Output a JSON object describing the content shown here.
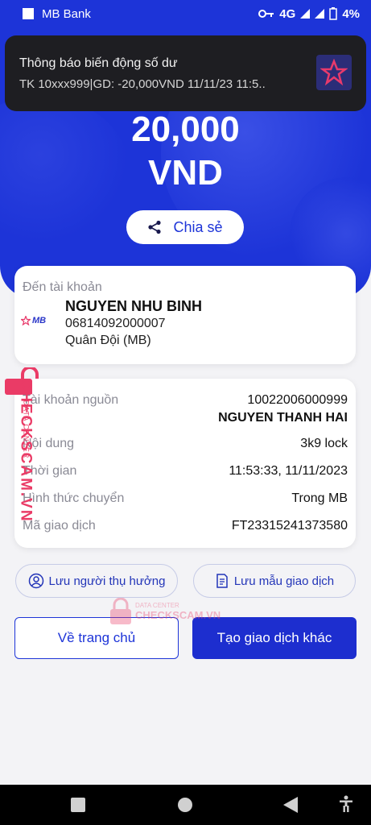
{
  "status_bar": {
    "app_name": "MB Bank",
    "network": "4G",
    "battery": "4%"
  },
  "notification": {
    "title": "Thông báo biến động số dư",
    "body": "TK 10xxx999|GD: -20,000VND 11/11/23 11:5.."
  },
  "amount": {
    "value": "20,000",
    "currency": "VND"
  },
  "share_label": "Chia sẻ",
  "recipient": {
    "label": "Đến tài khoản",
    "bank_logo": "MB",
    "name": "NGUYEN NHU BINH",
    "account": "06814092000007",
    "bank": "Quân Đội (MB)"
  },
  "details": {
    "source_label": "Tài khoản nguồn",
    "source_account": "10022006000999",
    "source_name": "NGUYEN THANH HAI",
    "content_label": "Nội dung",
    "content_value": "3k9 lock",
    "time_label": "Thời gian",
    "time_value": "11:53:33, 11/11/2023",
    "method_label": "Hình thức chuyển",
    "method_value": "Trong MB",
    "code_label": "Mã giao dịch",
    "code_value": "FT23315241373580"
  },
  "actions": {
    "save_beneficiary": "Lưu người thụ hưởng",
    "save_template": "Lưu mẫu giao dịch",
    "home": "Về trang chủ",
    "new_transaction": "Tạo giao dịch khác"
  },
  "watermark": {
    "brand": "CHECKSCAM.VN",
    "sub": "DATA CENTER"
  },
  "colors": {
    "primary": "#1d34d8",
    "watermark": "#ea3b66"
  }
}
